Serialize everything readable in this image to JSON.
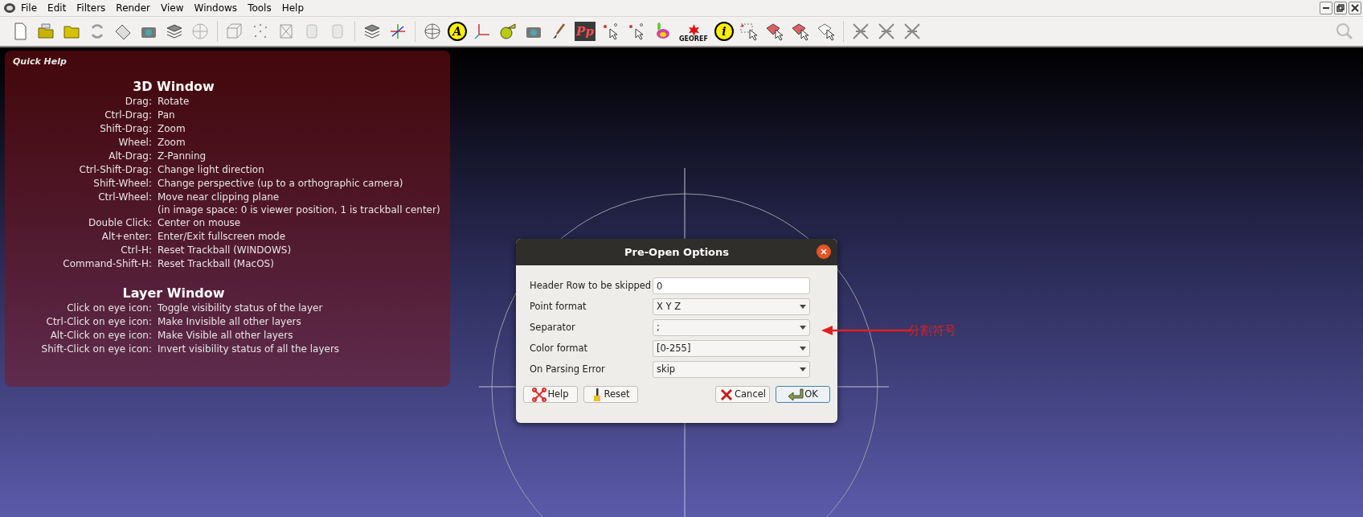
{
  "menu_bar": {
    "items": [
      "File",
      "Edit",
      "Filters",
      "Render",
      "View",
      "Windows",
      "Tools",
      "Help"
    ]
  },
  "toolbar": {
    "groups": [
      [
        {
          "kind": "new-file"
        },
        {
          "kind": "open-layers"
        },
        {
          "kind": "folder"
        },
        {
          "kind": "reload"
        },
        {
          "kind": "save"
        },
        {
          "kind": "camera"
        },
        {
          "kind": "layers"
        },
        {
          "kind": "globe"
        }
      ],
      [
        {
          "kind": "wire-cube"
        },
        {
          "kind": "points"
        },
        {
          "kind": "wire-box"
        },
        {
          "kind": "cylinder"
        },
        {
          "kind": "cylinder"
        }
      ],
      [
        {
          "kind": "layers"
        },
        {
          "kind": "axes"
        }
      ],
      [
        {
          "kind": "sphere"
        },
        {
          "kind": "letter",
          "glyph": "A"
        },
        {
          "kind": "corner-axes"
        },
        {
          "kind": "tape"
        },
        {
          "kind": "camera"
        },
        {
          "kind": "brush"
        },
        {
          "kind": "logo",
          "glyph": "Pp"
        },
        {
          "kind": "pick"
        },
        {
          "kind": "pick"
        },
        {
          "kind": "bunny"
        },
        {
          "kind": "georef",
          "glyph": "GEOREF"
        },
        {
          "kind": "letter",
          "glyph": "i"
        },
        {
          "kind": "select-rect"
        },
        {
          "kind": "select-faces"
        },
        {
          "kind": "select-faces"
        },
        {
          "kind": "select-outline"
        }
      ],
      [
        {
          "kind": "cross"
        },
        {
          "kind": "cross"
        },
        {
          "kind": "cross"
        }
      ]
    ]
  },
  "quick_help": {
    "title": "Quick Help",
    "sections": [
      {
        "heading": "3D Window",
        "rows": [
          {
            "key": "Drag:",
            "value": "Rotate"
          },
          {
            "key": "Ctrl-Drag:",
            "value": "Pan"
          },
          {
            "key": "Shift-Drag:",
            "value": "Zoom"
          },
          {
            "key": "Wheel:",
            "value": "Zoom"
          },
          {
            "key": "Alt-Drag:",
            "value": "Z-Panning"
          },
          {
            "key": "Ctrl-Shift-Drag:",
            "value": "Change light direction"
          },
          {
            "key": "Shift-Wheel:",
            "value": "Change perspective (up to a orthographic camera)"
          },
          {
            "key": "Ctrl-Wheel:",
            "value": "Move near clipping plane",
            "note": "(in image space: 0 is viewer position, 1 is trackball center)"
          },
          {
            "key": "Double Click:",
            "value": "Center on mouse"
          },
          {
            "key": "Alt+enter:",
            "value": "Enter/Exit fullscreen mode"
          },
          {
            "key": "Ctrl-H:",
            "value": "Reset Trackball (WINDOWS)"
          },
          {
            "key": "Command-Shift-H:",
            "value": "Reset Trackball (MacOS)"
          }
        ]
      },
      {
        "heading": "Layer Window",
        "rows": [
          {
            "key": "Click on eye icon:",
            "value": "Toggle visibility status of the layer"
          },
          {
            "key": "Ctrl-Click on eye icon:",
            "value": "Make Invisible all other layers"
          },
          {
            "key": "Alt-Click on eye icon:",
            "value": "Make Visible all other layers"
          },
          {
            "key": "Shift-Click on eye icon:",
            "value": "Invert visibility status of all the layers"
          }
        ]
      }
    ]
  },
  "dialog": {
    "title": "Pre-Open Options",
    "fields": [
      {
        "label": "Header Row to be skipped",
        "kind": "text",
        "value": "0"
      },
      {
        "label": "Point format",
        "kind": "select",
        "value": "X Y Z"
      },
      {
        "label": "Separator",
        "kind": "select",
        "value": ";"
      },
      {
        "label": "Color format",
        "kind": "select",
        "value": "[0-255]"
      },
      {
        "label": "On Parsing Error",
        "kind": "select",
        "value": "skip"
      }
    ],
    "buttons": [
      {
        "label": "Help",
        "kind": "help",
        "default": false
      },
      {
        "label": "Reset",
        "kind": "reset",
        "default": false
      },
      {
        "label": "Cancel",
        "kind": "cancel",
        "default": false
      },
      {
        "label": "OK",
        "kind": "ok",
        "default": true
      }
    ]
  },
  "annotation": {
    "text": "分割符号"
  }
}
